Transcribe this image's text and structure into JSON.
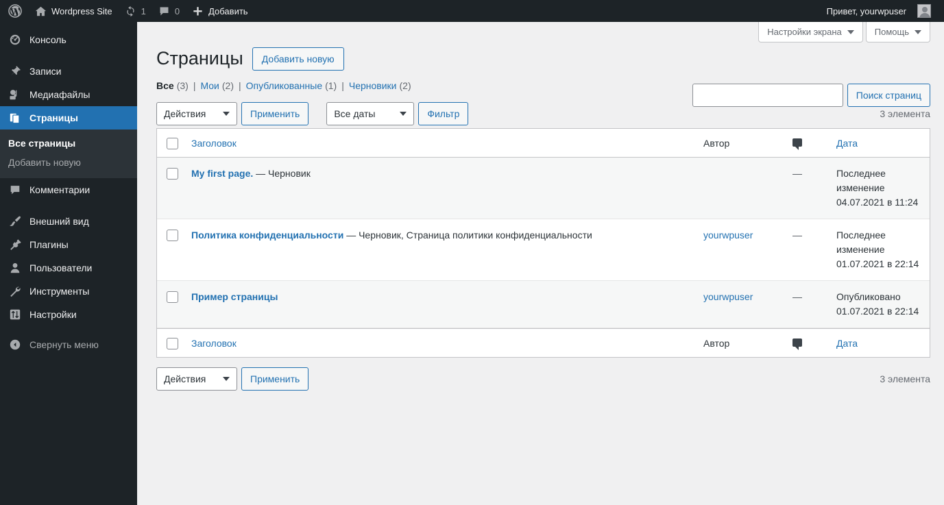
{
  "adminbar": {
    "logo_icon": "wordpress-logo-icon",
    "site_name": "Wordpress Site",
    "home_icon": "home-icon",
    "updates_icon": "updates-icon",
    "updates_count": "1",
    "comments_icon": "comment-icon",
    "comments_count": "0",
    "new_icon": "plus-icon",
    "new_label": "Добавить",
    "howdy": "Привет, yourwpuser",
    "avatar_icon": "avatar-icon"
  },
  "sidebar": {
    "items": [
      {
        "label": "Консоль",
        "icon": "dashboard-icon",
        "current": false
      },
      {
        "label": "Записи",
        "icon": "pin-icon",
        "current": false
      },
      {
        "label": "Медиафайлы",
        "icon": "media-icon",
        "current": false
      },
      {
        "label": "Страницы",
        "icon": "pages-icon",
        "current": true
      },
      {
        "label": "Комментарии",
        "icon": "comment-icon",
        "current": false
      },
      {
        "label": "Внешний вид",
        "icon": "appearance-brush-icon",
        "current": false
      },
      {
        "label": "Плагины",
        "icon": "plugin-icon",
        "current": false
      },
      {
        "label": "Пользователи",
        "icon": "users-icon",
        "current": false
      },
      {
        "label": "Инструменты",
        "icon": "tools-wrench-icon",
        "current": false
      },
      {
        "label": "Настройки",
        "icon": "settings-sliders-icon",
        "current": false
      }
    ],
    "submenu": [
      {
        "label": "Все страницы",
        "current": true
      },
      {
        "label": "Добавить новую",
        "current": false
      }
    ],
    "collapse_label": "Свернуть меню",
    "collapse_icon": "collapse-arrow-icon"
  },
  "screen_meta": {
    "screen_options": "Настройки экрана",
    "help": "Помощь"
  },
  "header": {
    "title": "Страницы",
    "add_new": "Добавить новую"
  },
  "views": [
    {
      "label": "Все",
      "count": "(3)",
      "current": true
    },
    {
      "label": "Мои",
      "count": "(2)",
      "current": false
    },
    {
      "label": "Опубликованные",
      "count": "(1)",
      "current": false
    },
    {
      "label": "Черновики",
      "count": "(2)",
      "current": false
    }
  ],
  "search": {
    "value": "",
    "placeholder": "",
    "button": "Поиск страниц"
  },
  "tablenav_top": {
    "bulk_actions": "Действия",
    "apply": "Применить",
    "date_filter": "Все даты",
    "filter": "Фильтр",
    "displaying_num": "3 элемента"
  },
  "tablenav_bottom": {
    "bulk_actions": "Действия",
    "apply": "Применить",
    "displaying_num": "3 элемента"
  },
  "table": {
    "columns": {
      "title": "Заголовок",
      "author": "Автор",
      "comments_icon": "comment-icon",
      "date": "Дата"
    },
    "rows": [
      {
        "title": "My first page.",
        "state": " — Черновик",
        "author": "",
        "comments": "—",
        "date_status": "Последнее изменение",
        "date_value": "04.07.2021 в 11:24"
      },
      {
        "title": "Политика конфиденциальности",
        "state": " — Черновик, Страница политики конфиденциальности",
        "author": "yourwpuser",
        "comments": "—",
        "date_status": "Последнее изменение",
        "date_value": "01.07.2021 в 22:14"
      },
      {
        "title": "Пример страницы",
        "state": "",
        "author": "yourwpuser",
        "comments": "—",
        "date_status": "Опубликовано",
        "date_value": "01.07.2021 в 22:14"
      }
    ]
  },
  "colors": {
    "admin_dark": "#1d2327",
    "submenu_bg": "#2c3338",
    "accent_blue": "#2271b1",
    "page_bg": "#f0f0f1",
    "border": "#c3c4c7"
  }
}
